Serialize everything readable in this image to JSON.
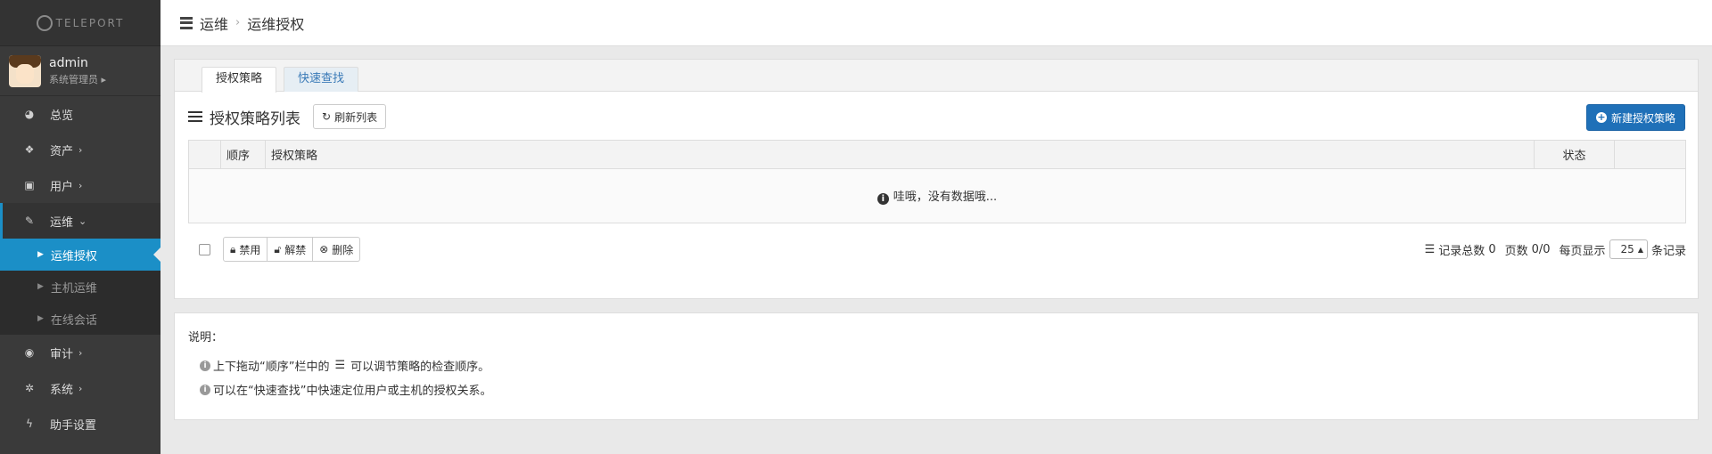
{
  "brand": {
    "text": "TELEPORT"
  },
  "user": {
    "name": "admin",
    "role": "系统管理员"
  },
  "nav": {
    "items": [
      {
        "label": "总览",
        "icon": "dashboard-icon"
      },
      {
        "label": "资产",
        "icon": "cubes-icon"
      },
      {
        "label": "用户",
        "icon": "address-book-icon"
      },
      {
        "label": "运维",
        "icon": "wrench-icon"
      }
    ],
    "sub_items": [
      "运维授权",
      "主机运维",
      "在线会话"
    ],
    "items_bottom": [
      {
        "label": "审计",
        "icon": "eye-icon"
      },
      {
        "label": "系统",
        "icon": "gear-icon"
      },
      {
        "label": "助手设置",
        "icon": "bolt-icon"
      }
    ]
  },
  "breadcrumb": {
    "section": "运维",
    "page": "运维授权"
  },
  "tabs": [
    "授权策略",
    "快速查找"
  ],
  "list": {
    "title": "授权策略列表",
    "refresh": "刷新列表",
    "create": "新建授权策略",
    "columns": [
      "",
      "顺序",
      "授权策略",
      "状态",
      ""
    ],
    "empty": "哇哦，没有数据哦..."
  },
  "actions": {
    "disable": "禁用",
    "unlock": "解禁",
    "delete": "删除"
  },
  "pager": {
    "total_label": "记录总数",
    "total": "0",
    "pages_label": "页数",
    "pages": "0/0",
    "per_page_label": "每页显示",
    "per_page": "25",
    "suffix": "条记录"
  },
  "notes": {
    "heading": "说明：",
    "line1_a": "上下拖动“顺序”栏中的",
    "line1_b": "可以调节策略的检查顺序。",
    "line2": "可以在“快速查找”中快速定位用户或主机的授权关系。"
  }
}
